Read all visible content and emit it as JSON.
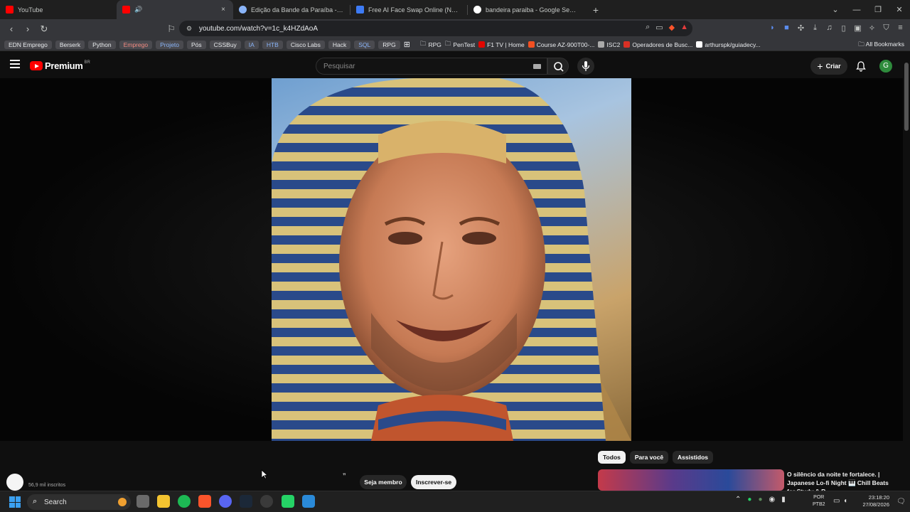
{
  "browser": {
    "tabs": [
      {
        "title": "YouTube",
        "favicon_color": "#ff0000",
        "active": false
      },
      {
        "title": "",
        "favicon_color": "#ff0000",
        "active": true,
        "audio_icon": "speaker-icon",
        "close": "×"
      },
      {
        "title": "Edição da Bande da Paraíba - Google",
        "favicon_color": "#8ab4f8",
        "active": false
      },
      {
        "title": "Free AI Face Swap Online (No Sign-u",
        "favicon_color": "#3d7bf5",
        "active": false
      },
      {
        "title": "bandeira paraiba - Google Search",
        "favicon_color": "#ffffff",
        "active": false
      }
    ],
    "new_tab": "+",
    "url": "youtube.com/watch?v=1c_k4HZdAoA",
    "bookmarks": [
      {
        "label": "EDN Emprego",
        "style": "pill",
        "color": "#e8eaed"
      },
      {
        "label": "Berserk",
        "style": "pill",
        "color": "#e8eaed"
      },
      {
        "label": "Python",
        "style": "pill",
        "color": "#e8eaed"
      },
      {
        "label": "Emprego",
        "style": "pill",
        "color": "#f28b82"
      },
      {
        "label": "Projeto",
        "style": "pill",
        "color": "#8ab4f8"
      },
      {
        "label": "Pós",
        "style": "pill",
        "color": "#e8eaed"
      },
      {
        "label": "CSSBuy",
        "style": "pill",
        "color": "#e8eaed"
      },
      {
        "label": "IA",
        "style": "pill",
        "color": "#8ab4f8"
      },
      {
        "label": "HTB",
        "style": "pill",
        "color": "#8ab4f8"
      },
      {
        "label": "Cisco Labs",
        "style": "pill",
        "color": "#e8eaed"
      },
      {
        "label": "Hack",
        "style": "pill",
        "color": "#e8eaed"
      },
      {
        "label": "SQL",
        "style": "pill",
        "color": "#8ab4f8"
      },
      {
        "label": "RPG",
        "style": "pill",
        "color": "#e8eaed"
      },
      {
        "label": "",
        "style": "grid",
        "color": "#e8eaed"
      },
      {
        "label": "RPG",
        "style": "folder",
        "color": "#e8eaed"
      },
      {
        "label": "PenTest",
        "style": "folder",
        "color": "#e8eaed"
      },
      {
        "label": "F1 TV | Home",
        "style": "site",
        "color": "#e8eaed",
        "icon_color": "#e10600"
      },
      {
        "label": "Course AZ-900T00-...",
        "style": "site",
        "color": "#e8eaed",
        "icon_color": "#f25022"
      },
      {
        "label": "ISC2",
        "style": "site",
        "color": "#e8eaed",
        "icon_color": "#aaaaaa"
      },
      {
        "label": "Operadores de Busc...",
        "style": "site",
        "color": "#e8eaed",
        "icon_color": "#d93025"
      },
      {
        "label": "arthurspk/guiadecy...",
        "style": "site",
        "color": "#e8eaed",
        "icon_color": "#ffffff"
      }
    ],
    "all_bookmarks": "All Bookmarks"
  },
  "youtube": {
    "logo_text": "Premium",
    "country_code": "BR",
    "search_placeholder": "Pesquisar",
    "create_label": "Criar",
    "avatar_letter": "G",
    "brand_color": "#ff0000"
  },
  "below_video": {
    "subscribers": "56,9 mil inscritos",
    "member_button": "Seja membro",
    "subscribe_button": "Inscrever-se",
    "chips": [
      "Todos",
      "Para você",
      "Assistidos"
    ],
    "recommendation_title": "O silêncio da noite te fortalece. | Japanese Lo-fi Night 🎹 Chill Beats for Study & R..."
  },
  "taskbar": {
    "search_label": "Search",
    "language": "POR",
    "layout": "PTB2",
    "time": "23:18:20",
    "date": "27/08/2026"
  }
}
